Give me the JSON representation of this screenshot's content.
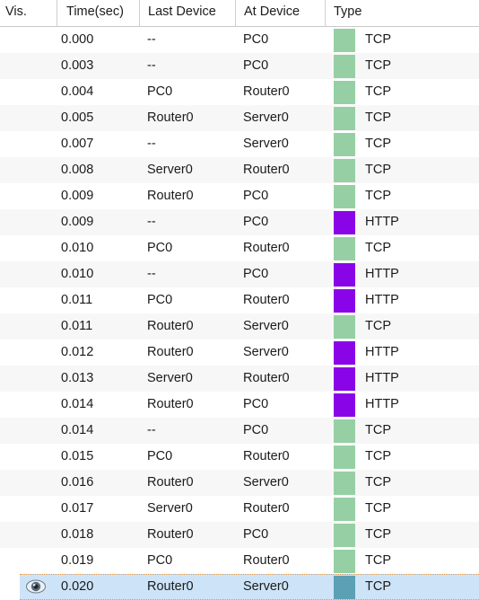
{
  "table": {
    "columns": [
      {
        "key": "vis",
        "label": "Vis."
      },
      {
        "key": "time",
        "label": "Time(sec)"
      },
      {
        "key": "last",
        "label": "Last Device"
      },
      {
        "key": "at",
        "label": "At Device"
      },
      {
        "key": "type",
        "label": "Type"
      }
    ],
    "colors": {
      "tcp_swatch": "#96cfa4",
      "http_swatch": "#8a04e8",
      "tcp_swatch_selected": "#5ba0b4",
      "selection_background": "#cde3f7",
      "focus_border": "#e8973b",
      "row_alt_background": "#f7f7f7",
      "row_background": "#ffffff",
      "text": "#1b1b1b",
      "header_divider": "#cfcfcf"
    },
    "rows": [
      {
        "vis": "",
        "time": "0.000",
        "last": "--",
        "at": "PC0",
        "type": "TCP",
        "swatch": "#96cfa4",
        "selected": false
      },
      {
        "vis": "",
        "time": "0.003",
        "last": "--",
        "at": "PC0",
        "type": "TCP",
        "swatch": "#96cfa4",
        "selected": false
      },
      {
        "vis": "",
        "time": "0.004",
        "last": "PC0",
        "at": "Router0",
        "type": "TCP",
        "swatch": "#96cfa4",
        "selected": false
      },
      {
        "vis": "",
        "time": "0.005",
        "last": "Router0",
        "at": "Server0",
        "type": "TCP",
        "swatch": "#96cfa4",
        "selected": false
      },
      {
        "vis": "",
        "time": "0.007",
        "last": "--",
        "at": "Server0",
        "type": "TCP",
        "swatch": "#96cfa4",
        "selected": false
      },
      {
        "vis": "",
        "time": "0.008",
        "last": "Server0",
        "at": "Router0",
        "type": "TCP",
        "swatch": "#96cfa4",
        "selected": false
      },
      {
        "vis": "",
        "time": "0.009",
        "last": "Router0",
        "at": "PC0",
        "type": "TCP",
        "swatch": "#96cfa4",
        "selected": false
      },
      {
        "vis": "",
        "time": "0.009",
        "last": "--",
        "at": "PC0",
        "type": "HTTP",
        "swatch": "#8a04e8",
        "selected": false
      },
      {
        "vis": "",
        "time": "0.010",
        "last": "PC0",
        "at": "Router0",
        "type": "TCP",
        "swatch": "#96cfa4",
        "selected": false
      },
      {
        "vis": "",
        "time": "0.010",
        "last": "--",
        "at": "PC0",
        "type": "HTTP",
        "swatch": "#8a04e8",
        "selected": false
      },
      {
        "vis": "",
        "time": "0.011",
        "last": "PC0",
        "at": "Router0",
        "type": "HTTP",
        "swatch": "#8a04e8",
        "selected": false
      },
      {
        "vis": "",
        "time": "0.011",
        "last": "Router0",
        "at": "Server0",
        "type": "TCP",
        "swatch": "#96cfa4",
        "selected": false
      },
      {
        "vis": "",
        "time": "0.012",
        "last": "Router0",
        "at": "Server0",
        "type": "HTTP",
        "swatch": "#8a04e8",
        "selected": false
      },
      {
        "vis": "",
        "time": "0.013",
        "last": "Server0",
        "at": "Router0",
        "type": "HTTP",
        "swatch": "#8a04e8",
        "selected": false
      },
      {
        "vis": "",
        "time": "0.014",
        "last": "Router0",
        "at": "PC0",
        "type": "HTTP",
        "swatch": "#8a04e8",
        "selected": false
      },
      {
        "vis": "",
        "time": "0.014",
        "last": "--",
        "at": "PC0",
        "type": "TCP",
        "swatch": "#96cfa4",
        "selected": false
      },
      {
        "vis": "",
        "time": "0.015",
        "last": "PC0",
        "at": "Router0",
        "type": "TCP",
        "swatch": "#96cfa4",
        "selected": false
      },
      {
        "vis": "",
        "time": "0.016",
        "last": "Router0",
        "at": "Server0",
        "type": "TCP",
        "swatch": "#96cfa4",
        "selected": false
      },
      {
        "vis": "",
        "time": "0.017",
        "last": "Server0",
        "at": "Router0",
        "type": "TCP",
        "swatch": "#96cfa4",
        "selected": false
      },
      {
        "vis": "",
        "time": "0.018",
        "last": "Router0",
        "at": "PC0",
        "type": "TCP",
        "swatch": "#96cfa4",
        "selected": false
      },
      {
        "vis": "",
        "time": "0.019",
        "last": "PC0",
        "at": "Router0",
        "type": "TCP",
        "swatch": "#96cfa4",
        "selected": false
      },
      {
        "vis": "eye-icon",
        "time": "0.020",
        "last": "Router0",
        "at": "Server0",
        "type": "TCP",
        "swatch": "#5ba0b4",
        "selected": true
      }
    ]
  }
}
